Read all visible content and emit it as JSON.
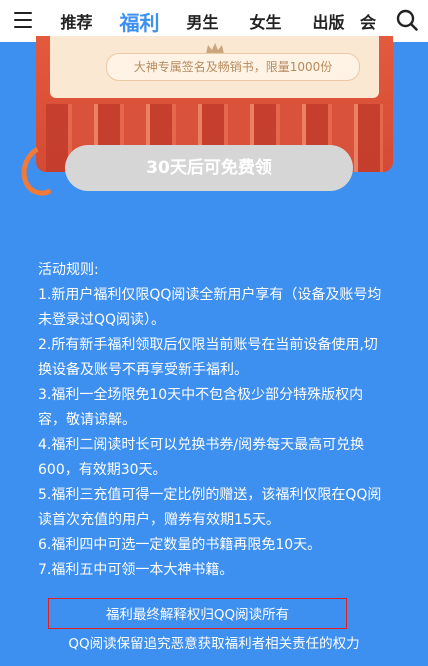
{
  "header": {
    "menu_icon": "menu-icon",
    "search_icon": "search-icon",
    "tabs": [
      {
        "label": "推荐"
      },
      {
        "label": "福利"
      },
      {
        "label": "男生"
      },
      {
        "label": "女生"
      },
      {
        "label": "出版"
      },
      {
        "label": "会"
      }
    ],
    "active_tab": "福利"
  },
  "card": {
    "perk_text": "大神专属签名及畅销书，限量1000份",
    "claim_button": "30天后可免费领"
  },
  "rules": {
    "title": "活动规则:",
    "items": [
      "1.新用户福利仅限QQ阅读全新用户享有（设备及账号均未登录过QQ阅读）。",
      "2.所有新手福利领取后仅限当前账号在当前设备使用,切换设备及账号不再享受新手福利。",
      "3.福利一全场限免10天中不包含极少部分特殊版权内容，敬请谅解。",
      "4.福利二阅读时长可以兑换书券/阅券每天最高可兑换600，有效期30天。",
      "5.福利三充值可得一定比例的赠送，该福利仅限在QQ阅读首次充值的用户，赠券有效期15天。",
      "6.福利四中可选一定数量的书籍再限免10天。",
      "7.福利五中可领一本大神书籍。"
    ]
  },
  "footer": {
    "line1": "福利最终解释权归QQ阅读所有",
    "line2": "QQ阅读保留追究恶意获取福利者相关责任的权力"
  },
  "colors": {
    "background": "#3d8ff0",
    "accent": "#3d8ff0",
    "card_red": "#e35a3e",
    "button_disabled": "#d6d6d6",
    "highlight_box": "#e02020"
  }
}
